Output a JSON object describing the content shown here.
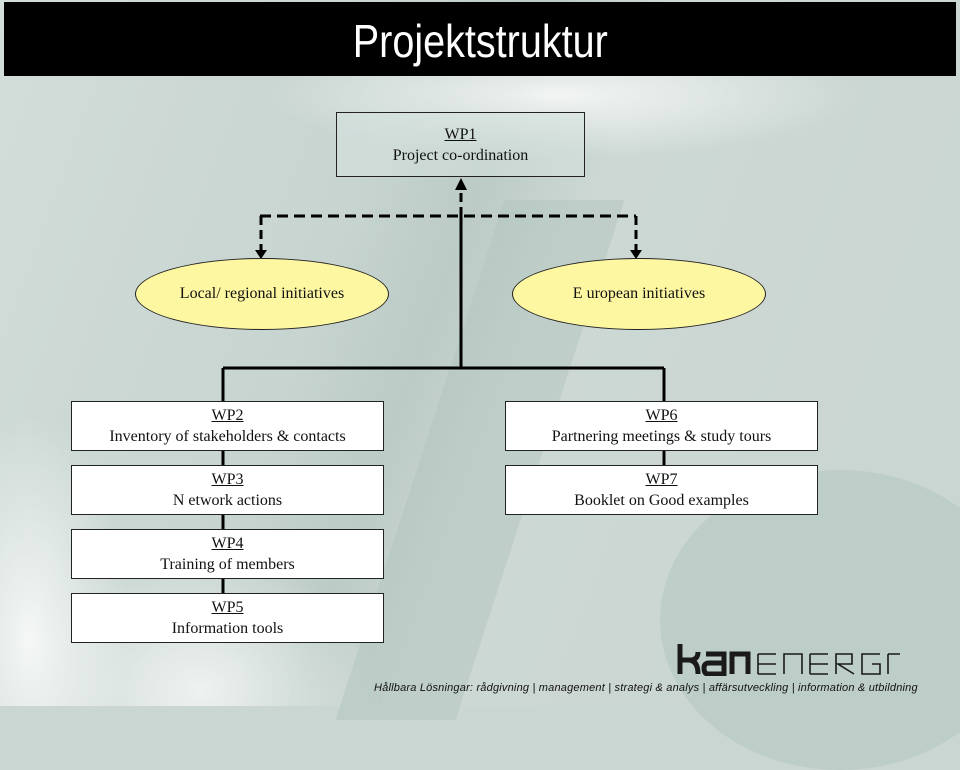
{
  "title": "Projektstruktur",
  "wp1": {
    "id": "WP1",
    "label": "Project co-ordination"
  },
  "initiatives": {
    "local": "Local/ regional initiatives",
    "european": "E uropean initiatives"
  },
  "left_column": [
    {
      "id": "WP2",
      "label": "Inventory of stakeholders & contacts"
    },
    {
      "id": "WP3",
      "label": "N etwork actions"
    },
    {
      "id": "WP4",
      "label": "Training of members"
    },
    {
      "id": "WP5",
      "label": "Information tools"
    }
  ],
  "right_column": [
    {
      "id": "WP6",
      "label": "Partnering meetings & study tours"
    },
    {
      "id": "WP7",
      "label": "Booklet on Good examples"
    }
  ],
  "footer": {
    "logo_text": "kanenergi",
    "tagline": "Hållbara Lösningar: rådgivning |  management  |  strategi & analys |  affärsutveckling |  information & utbildning"
  },
  "colors": {
    "title_bar": "#000000",
    "ellipse_fill": "#fdf7a2",
    "box_fill": "#ffffff",
    "background": "#c9d6d2"
  }
}
